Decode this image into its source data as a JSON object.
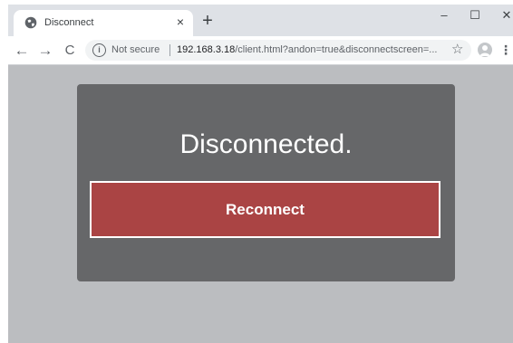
{
  "tab": {
    "title": "Disconnect",
    "favicon": "globe-icon",
    "close_glyph": "×"
  },
  "newtab_glyph": "+",
  "window_controls": {
    "minimize": "–",
    "maximize": "☐",
    "close": "✕"
  },
  "toolbar": {
    "back_glyph": "←",
    "forward_glyph": "→",
    "reload_glyph": "C",
    "info_glyph": "i",
    "not_secure": "Not secure",
    "url_host": "192.168.3.18",
    "url_path": "/client.html?andon=true&disconnectscreen=...",
    "star_glyph": "☆",
    "menu_glyph": "⋮"
  },
  "page": {
    "heading": "Disconnected.",
    "reconnect_label": "Reconnect"
  },
  "colors": {
    "page_background": "#bbbdc0",
    "panel_background": "#666769",
    "button_background": "#aa4444",
    "text_light": "#ffffff"
  }
}
